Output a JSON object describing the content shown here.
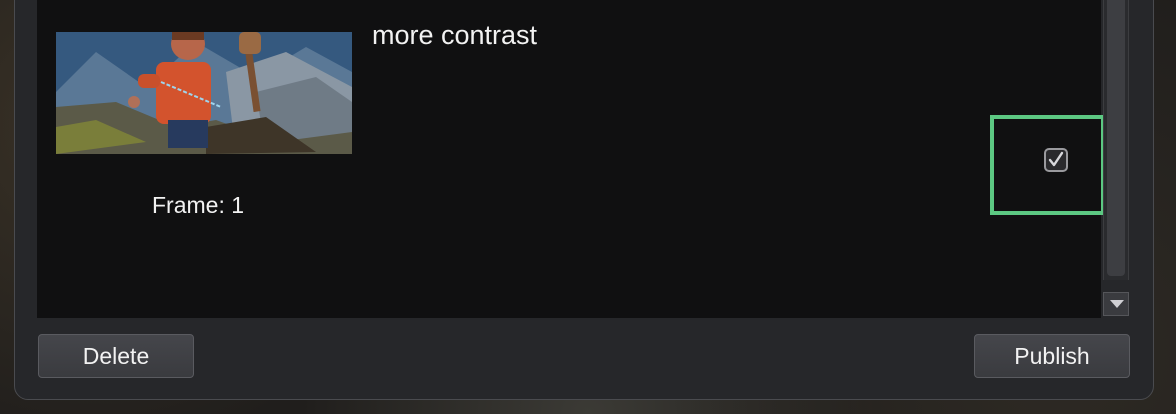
{
  "item": {
    "title": "more contrast",
    "frame_label": "Frame: 1",
    "checked": true,
    "thumbnail_icon": "character-scene-thumbnail"
  },
  "buttons": {
    "delete_label": "Delete",
    "publish_label": "Publish"
  },
  "colors": {
    "highlight": "#5cc882",
    "list_background": "#101011",
    "panel_background": "#26272a"
  }
}
